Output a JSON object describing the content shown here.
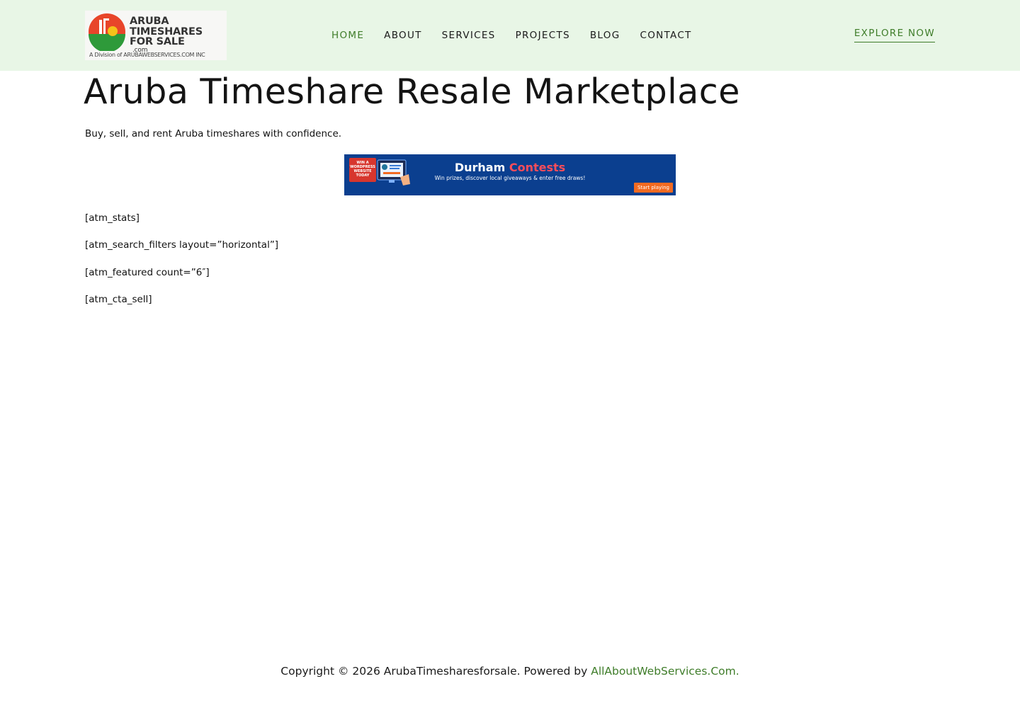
{
  "header": {
    "logo": {
      "line1": "ARUBA",
      "line2": "TIMESHARES",
      "line3": "FOR SALE",
      "dotcom": ".com",
      "division": "A Division of ARUBAWEBSERVICES.COM INC"
    },
    "nav": [
      {
        "label": "HOME",
        "active": true
      },
      {
        "label": "ABOUT",
        "active": false
      },
      {
        "label": "SERVICES",
        "active": false
      },
      {
        "label": "PROJECTS",
        "active": false
      },
      {
        "label": "BLOG",
        "active": false
      },
      {
        "label": "CONTACT",
        "active": false
      }
    ],
    "cta_label": "EXPLORE NOW"
  },
  "main": {
    "title": "Aruba Timeshare Resale Marketplace",
    "tagline": "Buy, sell, and rent Aruba timeshares with confidence.",
    "banner": {
      "badge": "WIN A WORDPRESS WEBSITE TODAY",
      "title_part1": "Durham ",
      "title_part2": "Contests",
      "subtitle": "Win prizes, discover local giveaways & enter free draws!",
      "cta": "Start playing",
      "icon": "wordpress-monitor-icon"
    },
    "shortcodes": [
      "[atm_stats]",
      "[atm_search_filters layout=”horizontal”]",
      "[atm_featured count=”6″]",
      "[atm_cta_sell]"
    ]
  },
  "footer": {
    "text": "Copyright © 2026 ArubaTimesharesforsale. Powered by ",
    "link": "AllAboutWebServices.Com."
  },
  "colors": {
    "header_bg": "#e8f6e6",
    "accent_green": "#3f7d2a",
    "banner_bg": "#0b3f8f",
    "banner_accent": "#ff4d5a",
    "banner_cta": "#f26a21"
  }
}
